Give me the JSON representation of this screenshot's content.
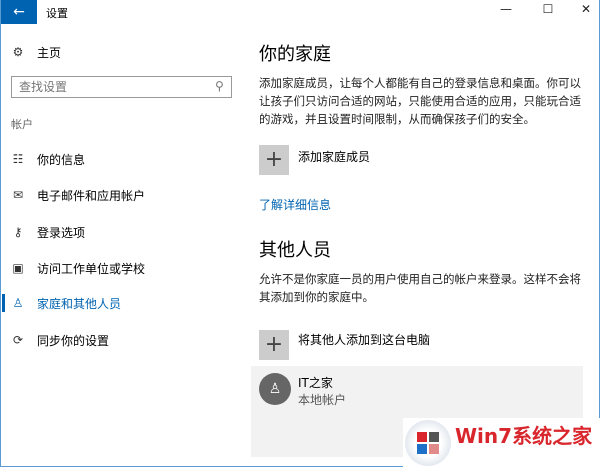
{
  "window": {
    "title": "设置",
    "back_icon": "arrow-left-icon",
    "min": "—",
    "max": "☐",
    "close": "✕"
  },
  "sidebar": {
    "home": "主页",
    "search_placeholder": "查找设置",
    "section": "帐户",
    "items": [
      {
        "label": "你的信息",
        "icon": "person-list-icon"
      },
      {
        "label": "电子邮件和应用帐户",
        "icon": "mail-icon"
      },
      {
        "label": "登录选项",
        "icon": "key-icon"
      },
      {
        "label": "访问工作单位或学校",
        "icon": "briefcase-icon"
      },
      {
        "label": "家庭和其他人员",
        "icon": "person-icon",
        "selected": true
      },
      {
        "label": "同步你的设置",
        "icon": "sync-icon"
      }
    ]
  },
  "main": {
    "family_title": "你的家庭",
    "family_desc": "添加家庭成员，让每个人都能有自己的登录信息和桌面。你可以让孩子们只访问合适的网站，只能使用合适的应用，只能玩合适的游戏，并且设置时间限制，从而确保孩子们的安全。",
    "add_family": "添加家庭成员",
    "learn_more": "了解详细信息",
    "others_title": "其他人员",
    "others_desc": "允许不是你家庭一员的用户使用自己的帐户来登录。这样不会将其添加到你的家庭中。",
    "add_other": "将其他人添加到这台电脑",
    "user": {
      "name": "IT之家",
      "type": "本地帐户"
    }
  },
  "watermark": {
    "text": "Win7系统之家",
    "accent": "#d9262c"
  },
  "colors": {
    "accent": "#0063b1",
    "card": "#f2f2f2"
  }
}
